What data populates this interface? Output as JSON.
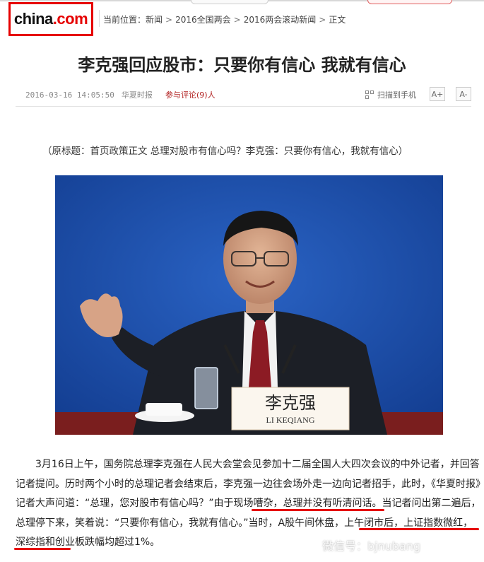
{
  "logo": {
    "part1": "china",
    "part2": ".",
    "part3": "com"
  },
  "breadcrumb": {
    "prefix": "当前位置：",
    "items": [
      "新闻",
      "2016全国两会",
      "2016两会滚动新闻",
      "正文"
    ],
    "separator": ">"
  },
  "article": {
    "title": "李克强回应股市：只要你有信心 我就有信心",
    "datetime": "2016-03-16 14:05:50",
    "source": "华夏时报",
    "comments_label": "参与评论(9)人",
    "scan_label": "扫描到手机",
    "font_increase": "A+",
    "font_decrease": "A-",
    "original_title": "（原标题：首页政策正文 总理对股市有信心吗？李克强：只要你有信心，我就有信心）",
    "nameplate_cn": "李克强",
    "nameplate_en": "LI KEQIANG",
    "body_text": "3月16日上午，国务院总理李克强在人民大会堂会见参加十二届全国人大四次会议的中外记者，并回答记者提问。历时两个小时的总理记者会结束后，李克强一边往会场外走一边向记者招手，此时，《华夏时报》记者大声问道：“总理，您对股市有信心吗？”由于现场嘈杂，总理并没有听清问话。当记者问出第二遍后，总理停下来，笑着说：“只要你有信心，我就有信心。”当时，A股午间休盘，上午闭市后，上证指数微红，深综指和创业板跌幅均超过1%。"
  },
  "watermark": "微信号：bjnubang",
  "colors": {
    "brand_red": "#e60000",
    "comment_red": "#b22222",
    "photo_bg": "#1b4fa8"
  }
}
